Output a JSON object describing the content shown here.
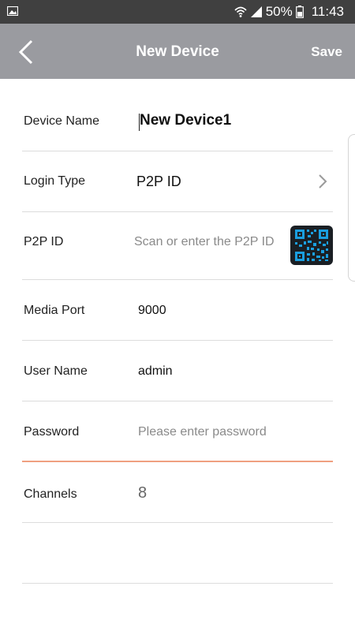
{
  "status_bar": {
    "battery_percent": "50%",
    "time": "11:43",
    "icons": [
      "image-icon",
      "wifi-icon",
      "signal-icon",
      "battery-icon"
    ]
  },
  "app_bar": {
    "title": "New Device",
    "save_label": "Save",
    "back_icon": "chevron-left-icon"
  },
  "form": {
    "device_name": {
      "label": "Device Name",
      "value": "New Device1"
    },
    "login_type": {
      "label": "Login Type",
      "value": "P2P ID"
    },
    "p2p_id": {
      "label": "P2P ID",
      "value": "",
      "placeholder": "Scan or enter the P2P ID"
    },
    "media_port": {
      "label": "Media Port",
      "value": "9000"
    },
    "user_name": {
      "label": "User Name",
      "value": "admin"
    },
    "password": {
      "label": "Password",
      "value": "",
      "placeholder": "Please enter password"
    },
    "channels": {
      "label": "Channels",
      "value": "8"
    }
  },
  "colors": {
    "status_bar": "#404040",
    "app_bar": "#9a9ba0",
    "active_underline": "#f0a080",
    "qr_accent": "#1a9fe0"
  }
}
